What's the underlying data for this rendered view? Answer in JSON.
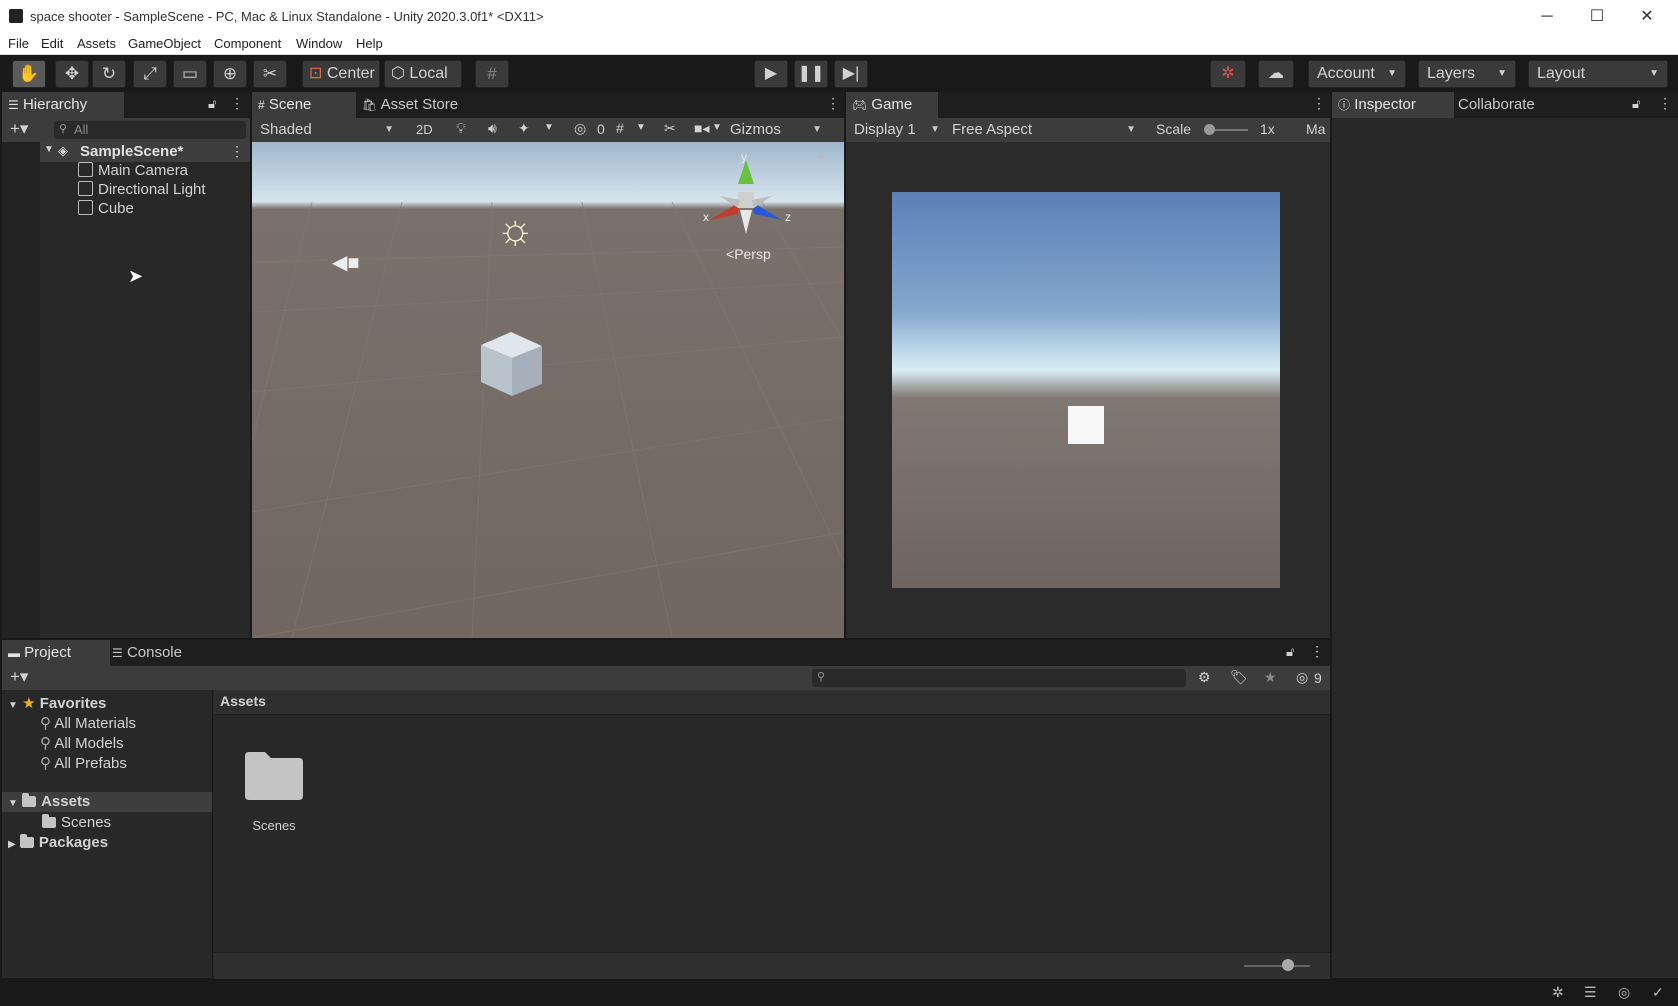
{
  "window": {
    "title": "space shooter - SampleScene - PC, Mac & Linux Standalone - Unity 2020.3.0f1* <DX11>",
    "minimize": "─",
    "maximize": "☐",
    "close": "✕"
  },
  "menu": [
    "File",
    "Edit",
    "Assets",
    "GameObject",
    "Component",
    "Window",
    "Help"
  ],
  "toolbar": {
    "pivot_label": "Center",
    "space_label": "Local",
    "account_label": "Account",
    "layers_label": "Layers",
    "layout_label": "Layout"
  },
  "hierarchy": {
    "tab": "Hierarchy",
    "search_placeholder": "All",
    "scene": "SampleScene*",
    "items": [
      "Main Camera",
      "Directional Light",
      "Cube"
    ]
  },
  "scene_view": {
    "tabs": [
      "Scene",
      "Asset Store"
    ],
    "shading": "Shaded",
    "mode_2d": "2D",
    "hidden_count": "0",
    "gizmos": "Gizmos",
    "persp_label": "Persp",
    "axis_x": "x",
    "axis_y": "y",
    "axis_z": "z"
  },
  "game_view": {
    "tab": "Game",
    "display": "Display 1",
    "aspect": "Free Aspect",
    "scale_label": "Scale",
    "scale_value": "1x",
    "maximize_partial": "Ma"
  },
  "inspector": {
    "tabs": [
      "Inspector",
      "Collaborate"
    ]
  },
  "project": {
    "tabs": [
      "Project",
      "Console"
    ],
    "favorites_label": "Favorites",
    "favorites": [
      "All Materials",
      "All Models",
      "All Prefabs"
    ],
    "assets_label": "Assets",
    "asset_children": [
      "Scenes"
    ],
    "packages_label": "Packages",
    "breadcrumb": "Assets",
    "hidden_packages_count": "9",
    "grid_items": [
      "Scenes"
    ]
  },
  "colors": {
    "accent": "#5a5a5a",
    "panel": "#282828",
    "selection": "#3e3e3e"
  }
}
